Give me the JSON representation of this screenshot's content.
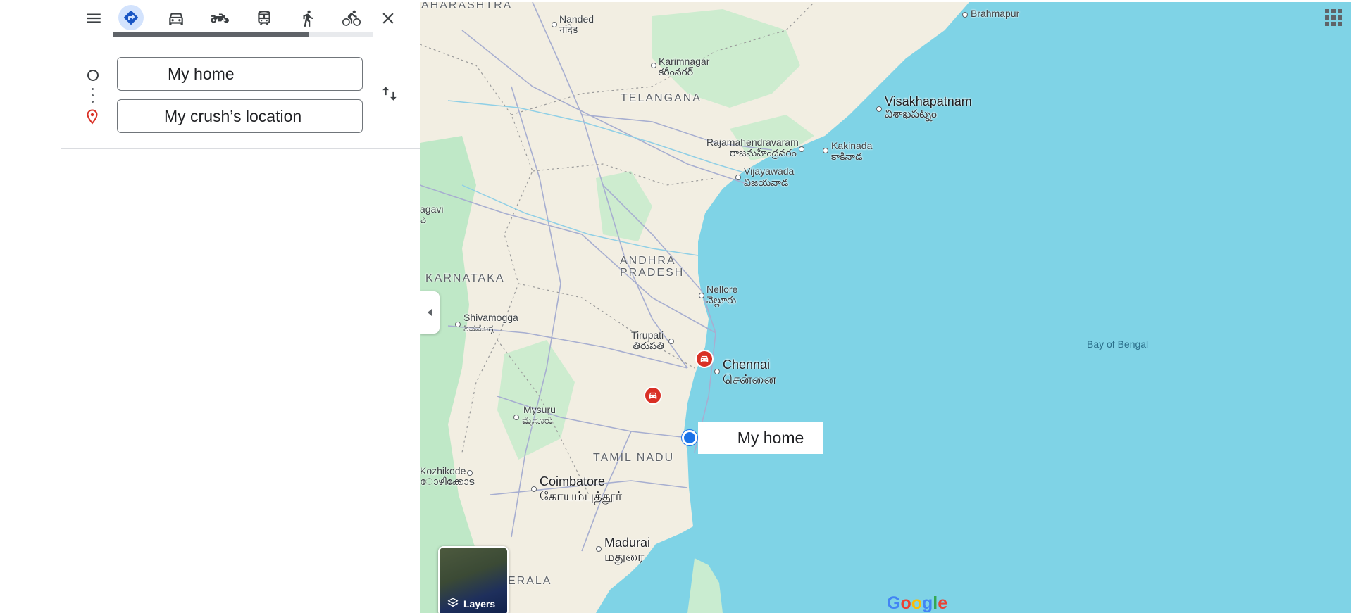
{
  "toolbar": {
    "modes": [
      {
        "name": "best",
        "icon": "directions-icon",
        "selected": true
      },
      {
        "name": "driving",
        "icon": "car-icon"
      },
      {
        "name": "two-wheeler",
        "icon": "motorcycle-icon"
      },
      {
        "name": "transit",
        "icon": "train-icon"
      },
      {
        "name": "walking",
        "icon": "walking-icon"
      },
      {
        "name": "cycling",
        "icon": "bicycle-icon"
      }
    ],
    "progress": 0.75
  },
  "route": {
    "origin": "My home",
    "destination": "My crush’s location"
  },
  "map": {
    "labels": {
      "maharashtra": "AHARASHTRA",
      "nanded": "Nanded",
      "nanded_local": "नांदेड",
      "brahmapur": "Brahmapur",
      "karimnagar": "Karimnagar",
      "karimnagar_local": "కరీంనగర్",
      "telangana": "TELANGANA",
      "visakhapatnam": "Visakhapatnam",
      "visakhapatnam_local": "విశాఖపట్నం",
      "rajamahendravaram": "Rajamahendravaram",
      "rajamahendravaram_local": "రాజమహేంద్రవరం",
      "kakinada": "Kakinada",
      "kakinada_local": "కాకినాడ",
      "vijayawada": "Vijayawada",
      "vijayawada_local": "విజయవాడ",
      "belagavi": "agavi",
      "belagavi_local": "ವಿ",
      "andhra_1": "ANDHRA",
      "andhra_2": "PRADESH",
      "karnataka": "KARNATAKA",
      "nellore": "Nellore",
      "nellore_local": "నెల్లూరు",
      "shivamogga": "Shivamogga",
      "shivamogga_local": "ಶಿವಮೊಗ್ಗ",
      "tirupati": "Tirupati",
      "tirupati_local": "తిరుపతి",
      "chennai": "Chennai",
      "chennai_local": "சென்னை",
      "bay_of_bengal": "Bay of Bengal",
      "mysuru": "Mysuru",
      "mysuru_local": "ಮೈಸೂರು",
      "tamil_nadu": "TAMIL NADU",
      "kozhikode": "Kozhikode",
      "kozhikode_local": "ോഴിക്കോട",
      "coimbatore": "Coimbatore",
      "coimbatore_local": "கோயம்புத்தூர்",
      "madurai": "Madurai",
      "madurai_local": "மதுரை",
      "kerala": "ERALA"
    },
    "home_label": "My home",
    "layers_label": "Layers",
    "attribution": "Google",
    "colors": {
      "water": "#7fd3e6",
      "land": "#f2eee2",
      "green": "#bfe8c7",
      "road": "#9aa3c9",
      "selected_mode": "#d3e3fd",
      "accent": "#1a73e8",
      "poi": "#d93025"
    }
  }
}
